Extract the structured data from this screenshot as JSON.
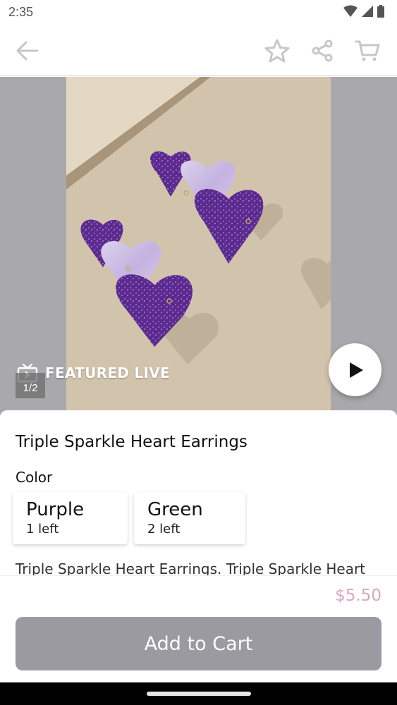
{
  "status_bar": {
    "time": "2:35"
  },
  "app_bar": {
    "back_icon": "arrow-left-icon",
    "favorite_icon": "star-icon",
    "share_icon": "share-icon",
    "cart_icon": "cart-icon"
  },
  "media": {
    "live_label": "FEATURED LIVE",
    "page_indicator": "1/2",
    "play_icon": "play-icon"
  },
  "product": {
    "title": "Triple Sparkle Heart Earrings",
    "color_label": "Color",
    "variants": [
      {
        "name": "Purple",
        "stock": "1 left"
      },
      {
        "name": "Green",
        "stock": "2 left"
      }
    ],
    "description": "Triple Sparkle Heart Earrings. Triple Sparkle Heart"
  },
  "footer": {
    "price": "$5.50",
    "add_to_cart_label": "Add to Cart"
  },
  "colors": {
    "price": "#d9a7bd",
    "button_disabled": "#9b9aa0",
    "glitter_purple": "#5b2a8e",
    "pearl_lilac": "#c9b8e3"
  }
}
